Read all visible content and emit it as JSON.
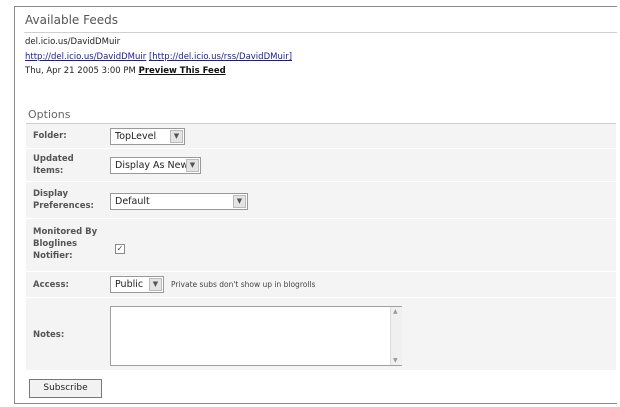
{
  "section": {
    "title": "Available Feeds"
  },
  "feed": {
    "name": "del.icio.us/DavidDMuir",
    "site_url": "http://del.icio.us/DavidDMuir",
    "feed_url": "[http://del.icio.us/rss/DavidDMuir]",
    "date": "Thu, Apr 21 2005 3:00 PM",
    "preview_label": "Preview This Feed"
  },
  "options": {
    "title": "Options",
    "folder": {
      "label": "Folder:",
      "value": "TopLevel"
    },
    "updated_items": {
      "label_line1": "Updated",
      "label_line2": "Items:",
      "value": "Display As New"
    },
    "display_preferences": {
      "label_line1": "Display",
      "label_line2": "Preferences:",
      "value": "Default"
    },
    "monitored": {
      "label_line1": "Monitored By",
      "label_line2": "Bloglines",
      "label_line3": "Notifier:",
      "checked": true,
      "check_glyph": "✓"
    },
    "access": {
      "label": "Access:",
      "value": "Public",
      "note": "Private subs don't show up in blogrolls"
    },
    "notes": {
      "label": "Notes:",
      "value": ""
    }
  },
  "subscribe_label": "Subscribe",
  "icons": {
    "dropdown": "chevron-down-icon",
    "scroll_up": "arrow-up-icon",
    "scroll_down": "arrow-down-icon"
  }
}
